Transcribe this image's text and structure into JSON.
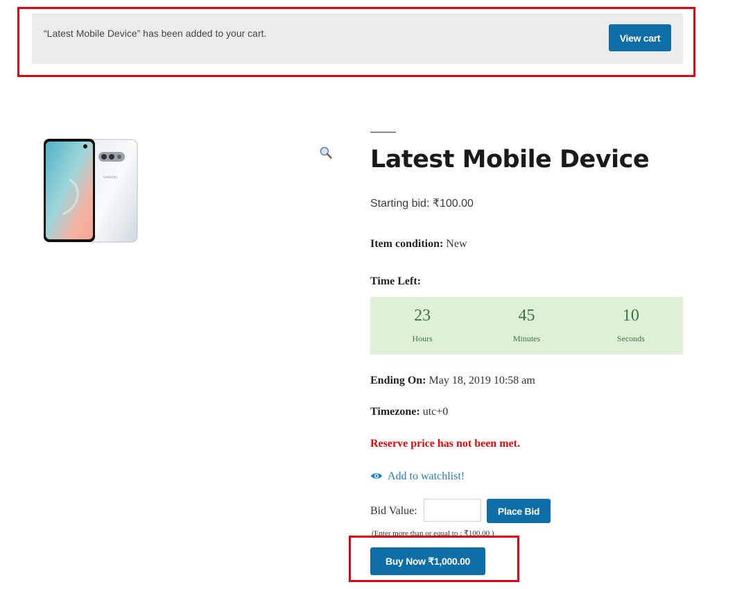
{
  "notice": {
    "message": "“Latest Mobile Device” has been added to your cart.",
    "view_cart_label": "View cart"
  },
  "product": {
    "title": "Latest Mobile Device",
    "starting_bid": "Starting bid: ₹100.00",
    "condition_label": "Item condition:",
    "condition_value": "New",
    "time_left_label": "Time Left:",
    "countdown": [
      {
        "value": "23",
        "unit": "Hours"
      },
      {
        "value": "45",
        "unit": "Minutes"
      },
      {
        "value": "10",
        "unit": "Seconds"
      }
    ],
    "ending_label": "Ending On:",
    "ending_value": "May 18, 2019 10:58 am",
    "timezone_label": "Timezone:",
    "timezone_value": "utc+0",
    "reserve_message": "Reserve price has not been met.",
    "watchlist_label": "Add to watchlist!",
    "bid_value_label": "Bid Value:",
    "bid_input_value": "",
    "place_bid_label": "Place Bid",
    "bid_hint": "(Enter more than or equal to : ₹100.00 )",
    "buy_now_label": "Buy Now ₹1,000.00"
  },
  "icons": {
    "zoom": "magnifier-icon",
    "watch": "eye-icon"
  },
  "colors": {
    "button": "#0e6ea8",
    "highlight": "#e3020f",
    "countdown_bg": "#def0d8",
    "countdown_text": "#3c763d",
    "reserve": "#e4060c",
    "link": "#1a7dbf"
  }
}
